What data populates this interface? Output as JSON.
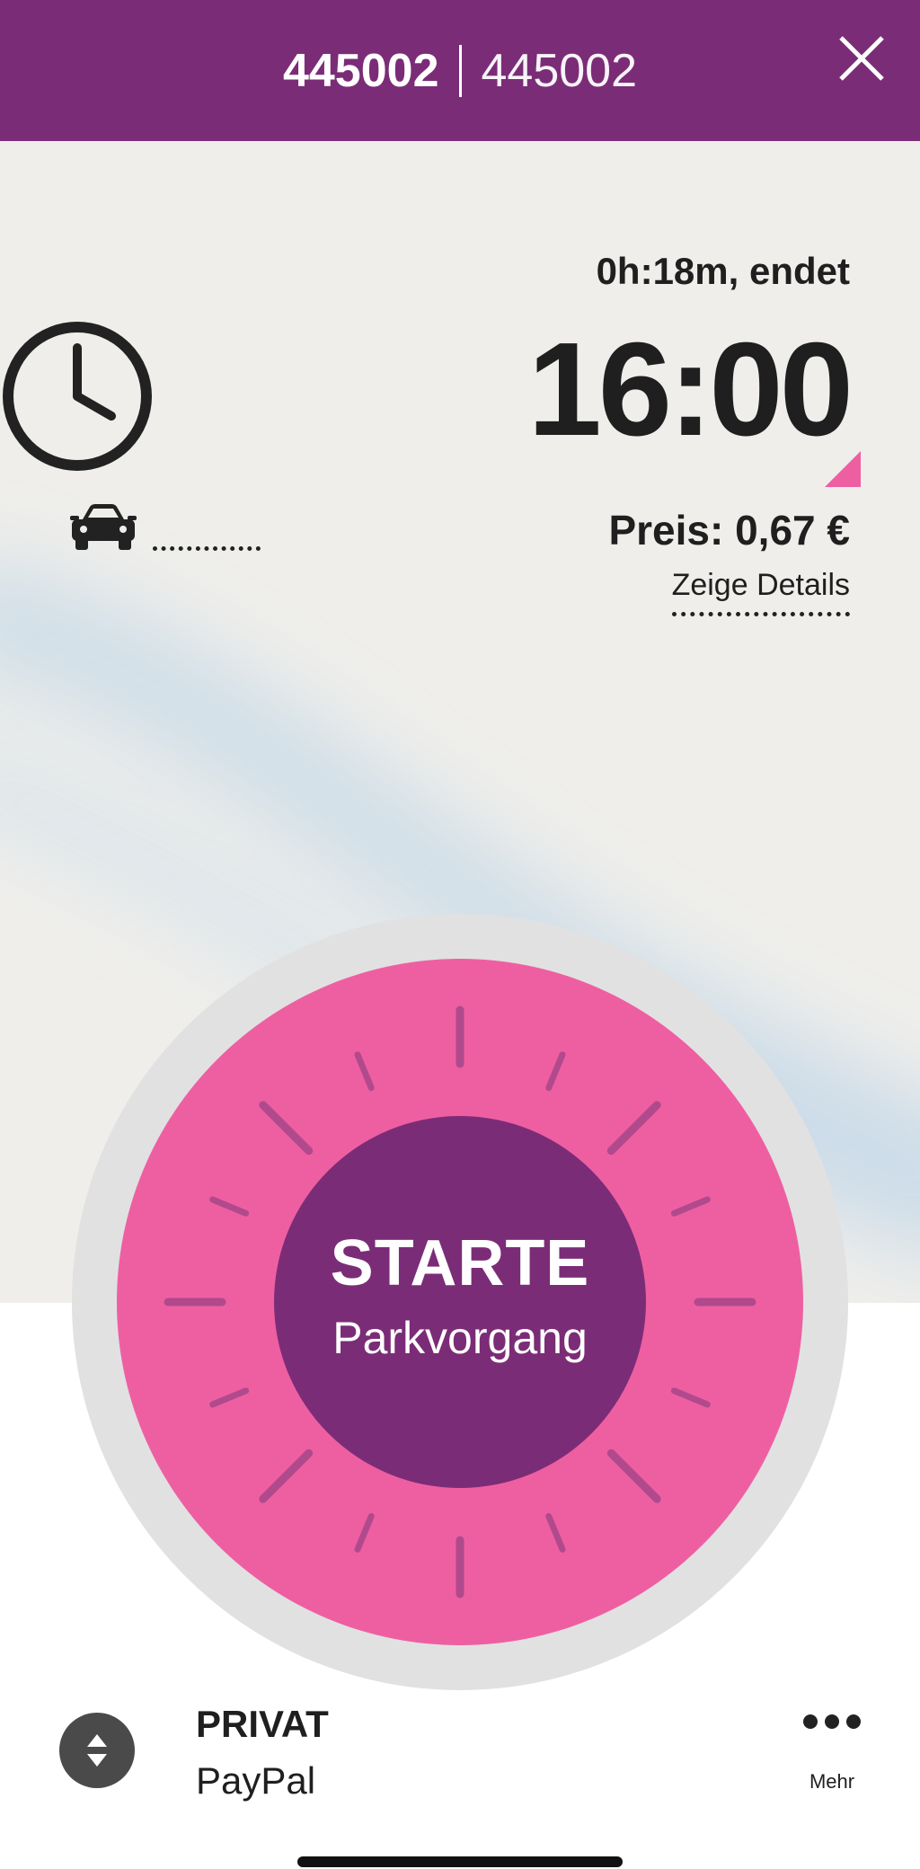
{
  "header": {
    "zone_number_bold": "445002",
    "zone_number_light": "445002",
    "close_icon": "close-icon"
  },
  "parking": {
    "duration_text": "0h:18m, endet",
    "end_time": "16:00",
    "price_text": "Preis: 0,67 €",
    "details_link": "Zeige Details",
    "clock_icon": "clock-icon",
    "car_icon": "car-icon"
  },
  "dial": {
    "button_title": "STARTE",
    "button_subtitle": "Parkvorgang"
  },
  "account": {
    "type": "PRIVAT",
    "payment_method": "PayPal",
    "more_label": "Mehr"
  },
  "colors": {
    "brand_purple": "#7b2c77",
    "accent_pink": "#ee5fa2",
    "dial_ring": "#e1e1e1"
  }
}
